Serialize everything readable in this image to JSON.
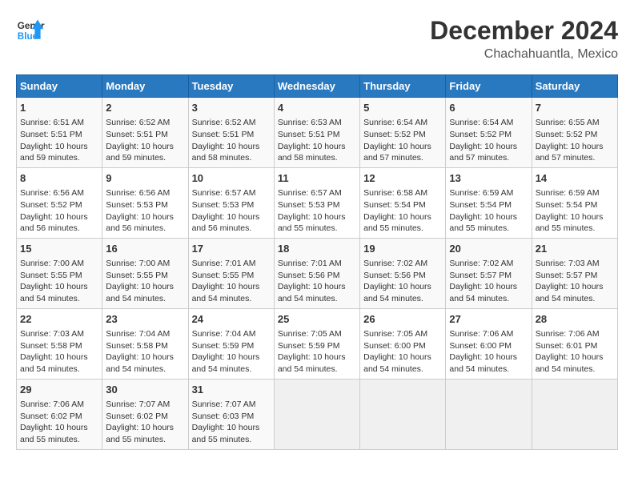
{
  "header": {
    "logo_line1": "General",
    "logo_line2": "Blue",
    "main_title": "December 2024",
    "sub_title": "Chachahuantla, Mexico"
  },
  "calendar": {
    "days_of_week": [
      "Sunday",
      "Monday",
      "Tuesday",
      "Wednesday",
      "Thursday",
      "Friday",
      "Saturday"
    ],
    "weeks": [
      [
        {
          "day": "",
          "empty": true
        },
        {
          "day": "",
          "empty": true
        },
        {
          "day": "",
          "empty": true
        },
        {
          "day": "",
          "empty": true
        },
        {
          "day": "",
          "empty": true
        },
        {
          "day": "",
          "empty": true
        },
        {
          "day": "",
          "empty": true
        }
      ],
      [
        {
          "num": "1",
          "sunrise": "6:51 AM",
          "sunset": "5:51 PM",
          "daylight": "10 hours and 59 minutes."
        },
        {
          "num": "2",
          "sunrise": "6:52 AM",
          "sunset": "5:51 PM",
          "daylight": "10 hours and 59 minutes."
        },
        {
          "num": "3",
          "sunrise": "6:52 AM",
          "sunset": "5:51 PM",
          "daylight": "10 hours and 58 minutes."
        },
        {
          "num": "4",
          "sunrise": "6:53 AM",
          "sunset": "5:51 PM",
          "daylight": "10 hours and 58 minutes."
        },
        {
          "num": "5",
          "sunrise": "6:54 AM",
          "sunset": "5:52 PM",
          "daylight": "10 hours and 57 minutes."
        },
        {
          "num": "6",
          "sunrise": "6:54 AM",
          "sunset": "5:52 PM",
          "daylight": "10 hours and 57 minutes."
        },
        {
          "num": "7",
          "sunrise": "6:55 AM",
          "sunset": "5:52 PM",
          "daylight": "10 hours and 57 minutes."
        }
      ],
      [
        {
          "num": "8",
          "sunrise": "6:56 AM",
          "sunset": "5:52 PM",
          "daylight": "10 hours and 56 minutes."
        },
        {
          "num": "9",
          "sunrise": "6:56 AM",
          "sunset": "5:53 PM",
          "daylight": "10 hours and 56 minutes."
        },
        {
          "num": "10",
          "sunrise": "6:57 AM",
          "sunset": "5:53 PM",
          "daylight": "10 hours and 56 minutes."
        },
        {
          "num": "11",
          "sunrise": "6:57 AM",
          "sunset": "5:53 PM",
          "daylight": "10 hours and 55 minutes."
        },
        {
          "num": "12",
          "sunrise": "6:58 AM",
          "sunset": "5:54 PM",
          "daylight": "10 hours and 55 minutes."
        },
        {
          "num": "13",
          "sunrise": "6:59 AM",
          "sunset": "5:54 PM",
          "daylight": "10 hours and 55 minutes."
        },
        {
          "num": "14",
          "sunrise": "6:59 AM",
          "sunset": "5:54 PM",
          "daylight": "10 hours and 55 minutes."
        }
      ],
      [
        {
          "num": "15",
          "sunrise": "7:00 AM",
          "sunset": "5:55 PM",
          "daylight": "10 hours and 54 minutes."
        },
        {
          "num": "16",
          "sunrise": "7:00 AM",
          "sunset": "5:55 PM",
          "daylight": "10 hours and 54 minutes."
        },
        {
          "num": "17",
          "sunrise": "7:01 AM",
          "sunset": "5:55 PM",
          "daylight": "10 hours and 54 minutes."
        },
        {
          "num": "18",
          "sunrise": "7:01 AM",
          "sunset": "5:56 PM",
          "daylight": "10 hours and 54 minutes."
        },
        {
          "num": "19",
          "sunrise": "7:02 AM",
          "sunset": "5:56 PM",
          "daylight": "10 hours and 54 minutes."
        },
        {
          "num": "20",
          "sunrise": "7:02 AM",
          "sunset": "5:57 PM",
          "daylight": "10 hours and 54 minutes."
        },
        {
          "num": "21",
          "sunrise": "7:03 AM",
          "sunset": "5:57 PM",
          "daylight": "10 hours and 54 minutes."
        }
      ],
      [
        {
          "num": "22",
          "sunrise": "7:03 AM",
          "sunset": "5:58 PM",
          "daylight": "10 hours and 54 minutes."
        },
        {
          "num": "23",
          "sunrise": "7:04 AM",
          "sunset": "5:58 PM",
          "daylight": "10 hours and 54 minutes."
        },
        {
          "num": "24",
          "sunrise": "7:04 AM",
          "sunset": "5:59 PM",
          "daylight": "10 hours and 54 minutes."
        },
        {
          "num": "25",
          "sunrise": "7:05 AM",
          "sunset": "5:59 PM",
          "daylight": "10 hours and 54 minutes."
        },
        {
          "num": "26",
          "sunrise": "7:05 AM",
          "sunset": "6:00 PM",
          "daylight": "10 hours and 54 minutes."
        },
        {
          "num": "27",
          "sunrise": "7:06 AM",
          "sunset": "6:00 PM",
          "daylight": "10 hours and 54 minutes."
        },
        {
          "num": "28",
          "sunrise": "7:06 AM",
          "sunset": "6:01 PM",
          "daylight": "10 hours and 54 minutes."
        }
      ],
      [
        {
          "num": "29",
          "sunrise": "7:06 AM",
          "sunset": "6:02 PM",
          "daylight": "10 hours and 55 minutes."
        },
        {
          "num": "30",
          "sunrise": "7:07 AM",
          "sunset": "6:02 PM",
          "daylight": "10 hours and 55 minutes."
        },
        {
          "num": "31",
          "sunrise": "7:07 AM",
          "sunset": "6:03 PM",
          "daylight": "10 hours and 55 minutes."
        },
        {
          "empty": true
        },
        {
          "empty": true
        },
        {
          "empty": true
        },
        {
          "empty": true
        }
      ]
    ]
  }
}
